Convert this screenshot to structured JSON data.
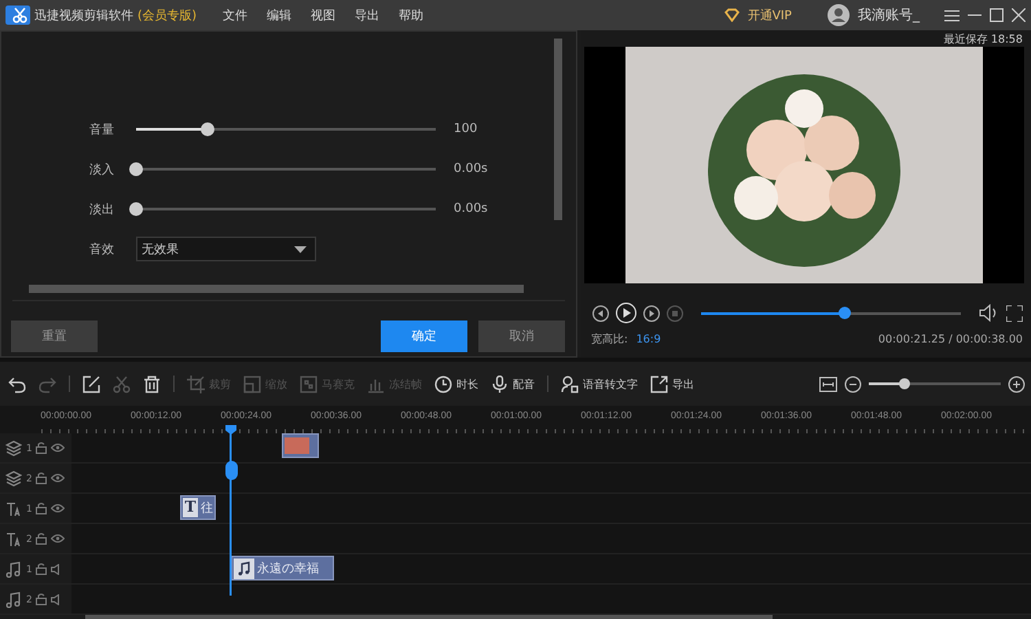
{
  "title_bar": {
    "app_name": "迅捷视频剪辑软件",
    "edition": "(会员专版)",
    "menus": [
      "文件",
      "编辑",
      "视图",
      "导出",
      "帮助"
    ],
    "vip_label": "开通VIP",
    "account_name": "我滴账号_"
  },
  "save_status": "最近保存 18:58",
  "audio_panel": {
    "sliders": [
      {
        "label": "音量",
        "level": 0.24,
        "reading": "100"
      },
      {
        "label": "淡入",
        "level": 0,
        "reading": "0.00s"
      },
      {
        "label": "淡出",
        "level": 0,
        "reading": "0.00s"
      }
    ],
    "effect": {
      "label": "音效",
      "value": "无效果"
    },
    "buttons": [
      {
        "label": "重置",
        "kind": "secondary"
      },
      {
        "label": "确定",
        "kind": "primary"
      },
      {
        "label": "取消",
        "kind": "secondary"
      }
    ]
  },
  "preview": {
    "progress": {
      "level": 0.555
    },
    "aspect_label": "宽高比:",
    "aspect_value": "16:9",
    "time": "00:00:21.25 / 00:00:38.00"
  },
  "toolbar": {
    "items": [
      {
        "disabled": false
      },
      {
        "disabled": true
      },
      {
        "disabled": false
      },
      {
        "disabled": true
      },
      {
        "disabled": false
      },
      {
        "label": "裁剪",
        "disabled": true
      },
      {
        "label": "缩放",
        "disabled": true
      },
      {
        "label": "马赛克",
        "disabled": true
      },
      {
        "label": "冻结帧",
        "disabled": true
      },
      {
        "label": "时长",
        "disabled": false
      },
      {
        "label": "配音",
        "disabled": false
      },
      {
        "label": "语音转文字",
        "disabled": false
      },
      {
        "label": "导出",
        "disabled": false
      }
    ],
    "zoom": {
      "level": 0.27
    }
  },
  "timeline": {
    "ruler_labels": [
      "00:00:00.00",
      "00:00:12.00",
      "00:00:24.00",
      "00:00:36.00",
      "00:00:48.00",
      "00:01:00.00",
      "00:01:12.00",
      "00:01:24.00",
      "00:01:36.00",
      "00:01:48.00",
      "00:02:00.00"
    ],
    "tracks": [
      {
        "kind": "video",
        "number": "1",
        "clips": [
          {
            "kind": "image"
          }
        ]
      },
      {
        "kind": "video",
        "number": "2"
      },
      {
        "kind": "text",
        "number": "1",
        "clips": [
          {
            "kind": "text",
            "icon_letter": "T",
            "label": "往"
          }
        ]
      },
      {
        "kind": "text",
        "number": "2"
      },
      {
        "kind": "audio",
        "number": "1",
        "clips": [
          {
            "kind": "audio",
            "label": "永遠の幸福"
          }
        ]
      },
      {
        "kind": "audio",
        "number": "2"
      }
    ]
  }
}
